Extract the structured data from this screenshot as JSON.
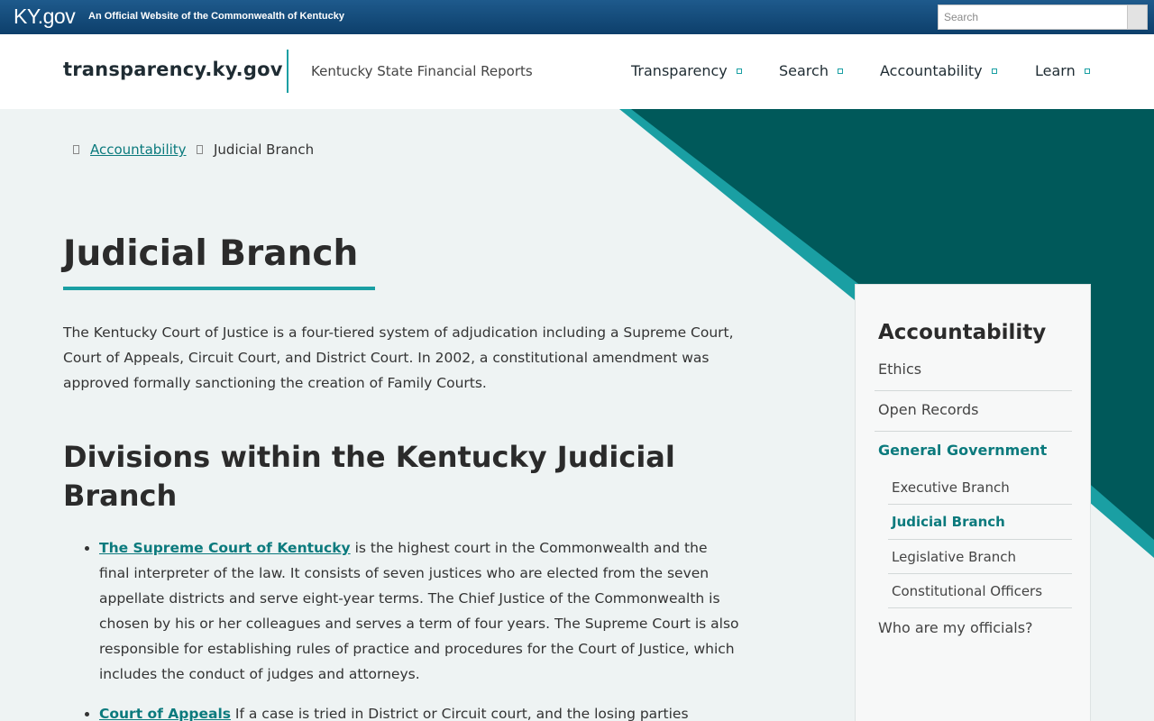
{
  "topbar": {
    "brand": "KY.gov",
    "official": "An Official Website of the Commonwealth of Kentucky",
    "search_placeholder": "Search"
  },
  "header": {
    "site_name": "transparency.ky.gov",
    "site_subtitle": "Kentucky State Financial Reports",
    "nav": [
      "Transparency",
      "Search",
      "Accountability",
      "Learn"
    ]
  },
  "breadcrumb": {
    "parent": "Accountability",
    "current": "Judicial Branch"
  },
  "main": {
    "title": "Judicial Branch",
    "intro": "The Kentucky Court of Justice is a four-tiered system of adjudication including a Supreme Court, Court of Appeals, Circuit Court, and District Court. In 2002, a constitutional amendment was approved formally sanctioning the creation of Family Courts.",
    "section_heading": "Divisions within the Kentucky Judicial Branch",
    "divisions": [
      {
        "link": "The Supreme Court of Kentucky",
        "text": " is the highest court in the Commonwealth and the final interpreter of the law. It consists of seven justices who are elected from the seven appellate districts and serve eight-year terms. The Chief Justice of the Commonwealth is chosen by his or her colleagues and serves a term of four years. The Supreme Court is also responsible for establishing rules of practice and procedures for the Court of Justice, which includes the conduct of judges and attorneys."
      },
      {
        "link": "Court of Appeals",
        "text": " If a case is tried in District or Circuit court, and the losing parties"
      }
    ]
  },
  "sidebar": {
    "title": "Accountability",
    "items": [
      "Ethics",
      "Open Records",
      "General Government"
    ],
    "sub_items": [
      "Executive Branch",
      "Judicial Branch",
      "Legislative Branch",
      "Constitutional Officers"
    ],
    "last_item": "Who are my officials?"
  },
  "colors": {
    "accent_teal": "#1a9fa3",
    "dark_teal": "#00595a",
    "link_teal": "#0b7a7d",
    "topbar_blue": "#0d3f6b"
  }
}
